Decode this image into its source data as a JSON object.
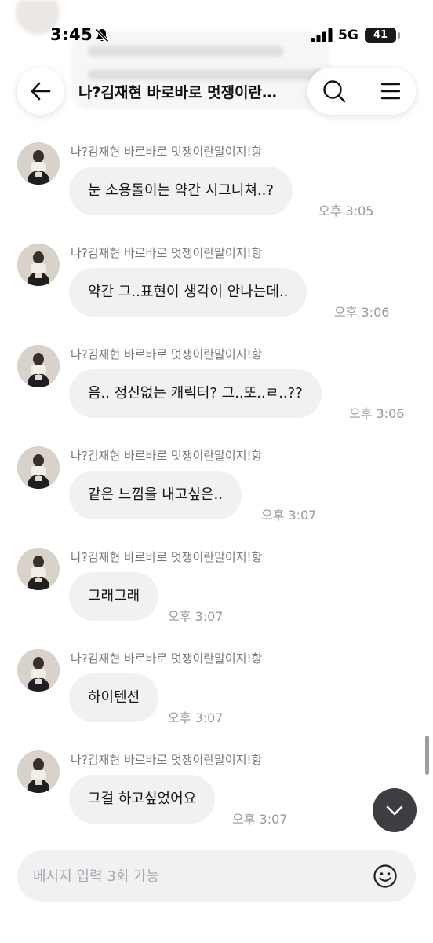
{
  "status_bar": {
    "time": "3:45",
    "network": "5G",
    "battery_level": "41"
  },
  "header": {
    "title": "나?김재현 바로바로 멋쟁이란말이지!항",
    "back_icon": "arrow-left-icon",
    "search_icon": "search-icon",
    "menu_icon": "hamburger-menu-icon"
  },
  "messages": [
    {
      "sender": "나?김재현 바로바로 멋쟁이란말이지!항",
      "text": "눈 소용돌이는 약간 시그니쳐..?",
      "time": "오후 3:05"
    },
    {
      "sender": "나?김재현 바로바로 멋쟁이란말이지!항",
      "text": "약간 그..표현이 생각이 안나는데..",
      "time": "오후 3:06"
    },
    {
      "sender": "나?김재현 바로바로 멋쟁이란말이지!항",
      "text": "음.. 정신없는 캐릭터? 그..또..ㄹ..??",
      "time": "오후 3:06"
    },
    {
      "sender": "나?김재현 바로바로 멋쟁이란말이지!항",
      "text": "같은 느낌을 내고싶은..",
      "time": "오후 3:07"
    },
    {
      "sender": "나?김재현 바로바로 멋쟁이란말이지!항",
      "text": "그래그래",
      "time": "오후 3:07"
    },
    {
      "sender": "나?김재현 바로바로 멋쟁이란말이지!항",
      "text": "하이텐션",
      "time": "오후 3:07"
    },
    {
      "sender": "나?김재현 바로바로 멋쟁이란말이지!항",
      "text": "그걸 하고싶었어요",
      "time": "오후 3:07"
    }
  ],
  "input": {
    "placeholder": "메시지 입력 3회 가능",
    "emoji_icon": "smiley-icon"
  },
  "scroll_down_icon": "chevron-down-icon",
  "colors": {
    "bubble": "#f1f1f3",
    "timestamp": "#999999",
    "scroll_button": "#3d3e42"
  }
}
